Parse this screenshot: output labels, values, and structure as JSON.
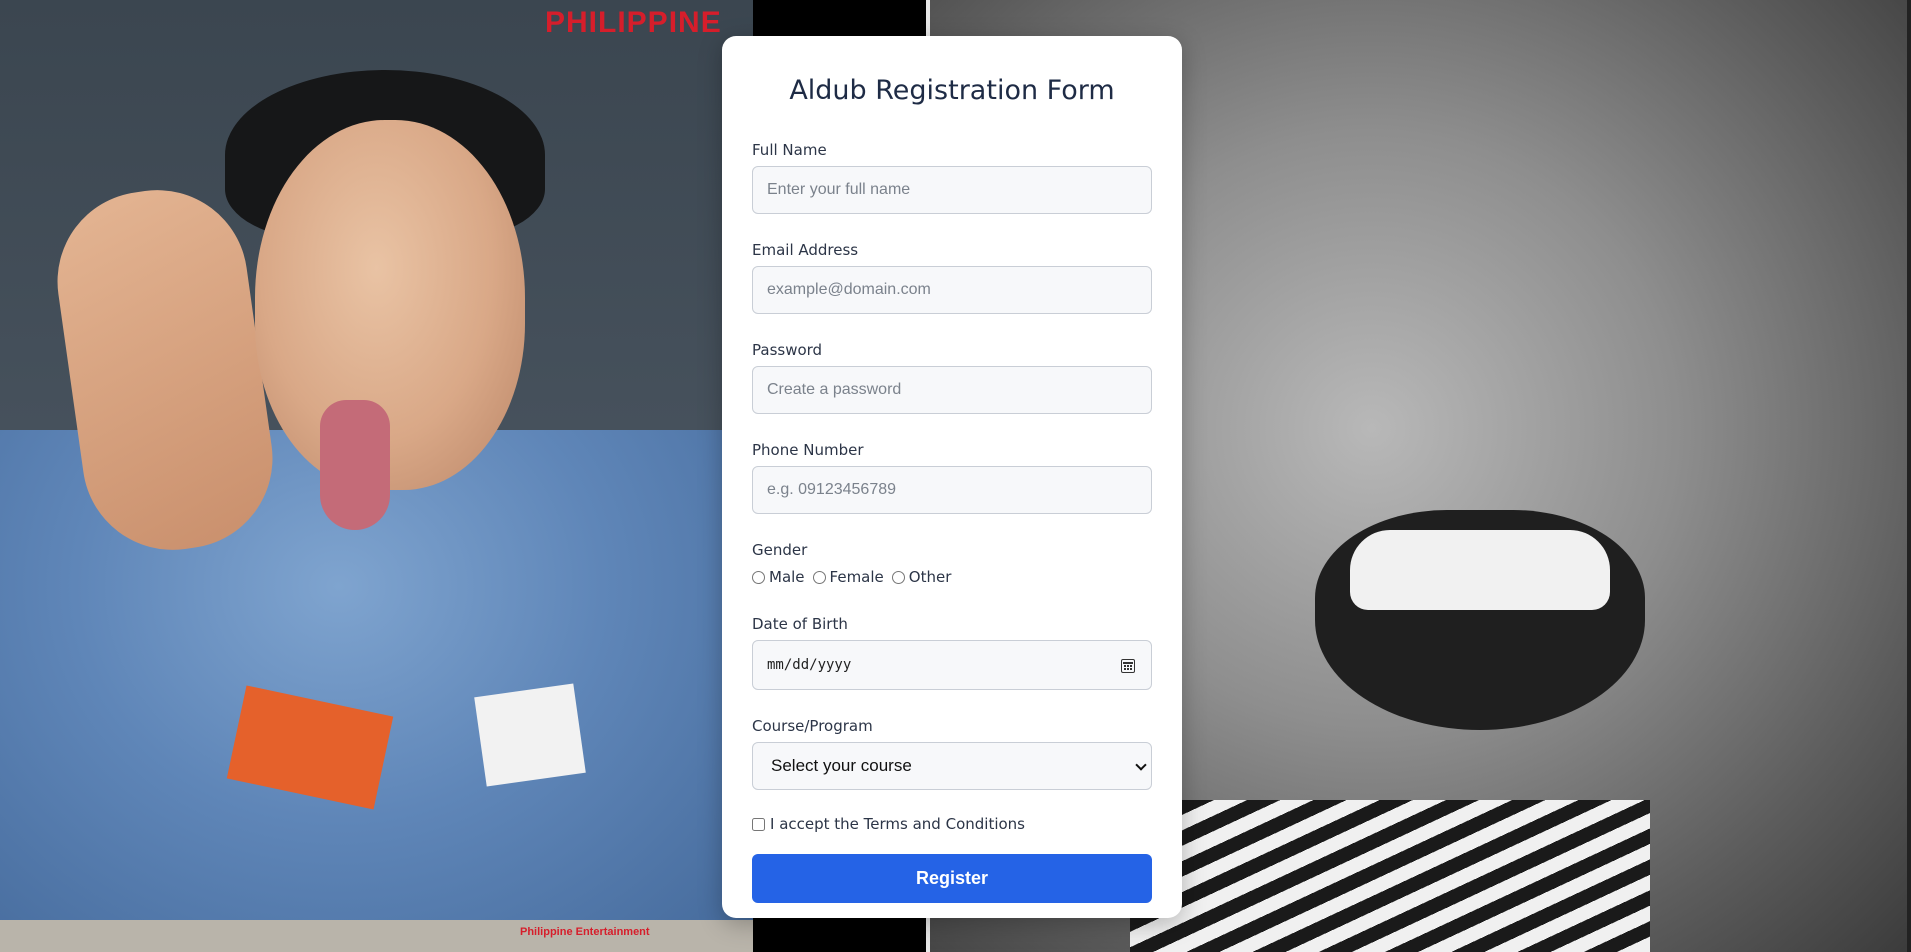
{
  "background": {
    "watermark_text": "PHILIPPINE",
    "watermark_footer": "Philippine Entertainment",
    "brand_color": "#d61e2b"
  },
  "form": {
    "title": "Aldub Registration Form",
    "full_name": {
      "label": "Full Name",
      "placeholder": "Enter your full name"
    },
    "email": {
      "label": "Email Address",
      "placeholder": "example@domain.com"
    },
    "password": {
      "label": "Password",
      "placeholder": "Create a password"
    },
    "phone": {
      "label": "Phone Number",
      "placeholder": "e.g. 09123456789"
    },
    "gender": {
      "label": "Gender",
      "options": [
        "Male",
        "Female",
        "Other"
      ]
    },
    "dob": {
      "label": "Date of Birth",
      "value": "mm/dd/yyyy"
    },
    "course": {
      "label": "Course/Program",
      "selected": "Select your course"
    },
    "terms_label": "I accept the Terms and Conditions",
    "submit_label": "Register",
    "accent_color": "#2563e6"
  }
}
